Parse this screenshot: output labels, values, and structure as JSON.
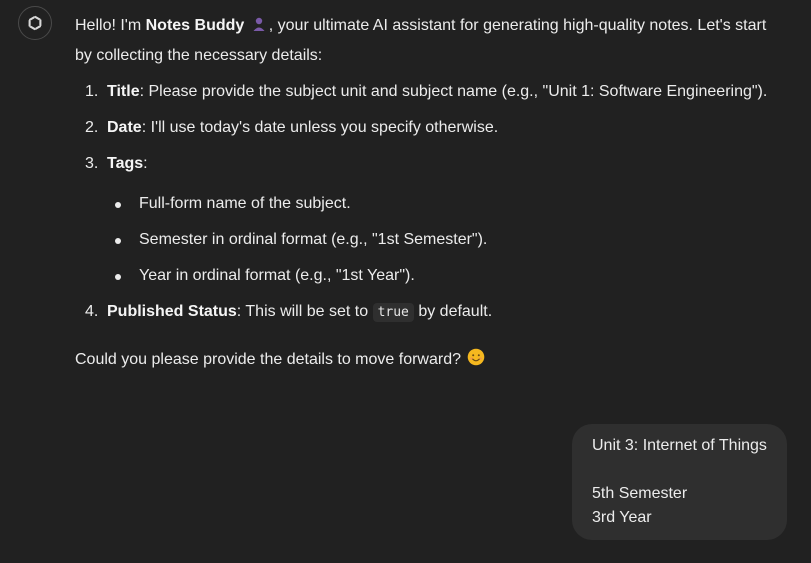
{
  "assistant": {
    "intro_prefix": "Hello! I'm ",
    "bot_name": "Notes Buddy",
    "intro_suffix_line1": ", your ultimate AI assistant for generating high-quality notes. Let's start",
    "intro_line2": "by collecting the necessary details:",
    "steps": [
      {
        "number": "1.",
        "label": "Title",
        "text": ": Please provide the subject unit and subject name (e.g., \"Unit 1: Software Engineering\")."
      },
      {
        "number": "2.",
        "label": "Date",
        "text": ": I'll use today's date unless you specify otherwise."
      },
      {
        "number": "3.",
        "label": "Tags",
        "text": ":"
      },
      {
        "number": "4.",
        "label": "Published Status",
        "text_before": ": This will be set to ",
        "code": "true",
        "text_after": " by default."
      }
    ],
    "tag_bullets": [
      "Full-form name of the subject.",
      "Semester in ordinal format (e.g., \"1st Semester\").",
      "Year in ordinal format (e.g., \"1st Year\")."
    ],
    "closing": "Could you please provide the details to move forward? "
  },
  "user_message": {
    "lines": [
      "Unit 3: Internet of Things",
      "",
      "5th Semester",
      "3rd Year"
    ]
  },
  "icons": {
    "avatar": "openai-logo-icon",
    "bot_emoji": "person-icon",
    "closing_emoji": "smiling-face-icon"
  },
  "colors": {
    "background": "#212121",
    "text": "#ececec",
    "user_bubble": "#2f2f2f",
    "code_bg": "#2f2f2f"
  }
}
